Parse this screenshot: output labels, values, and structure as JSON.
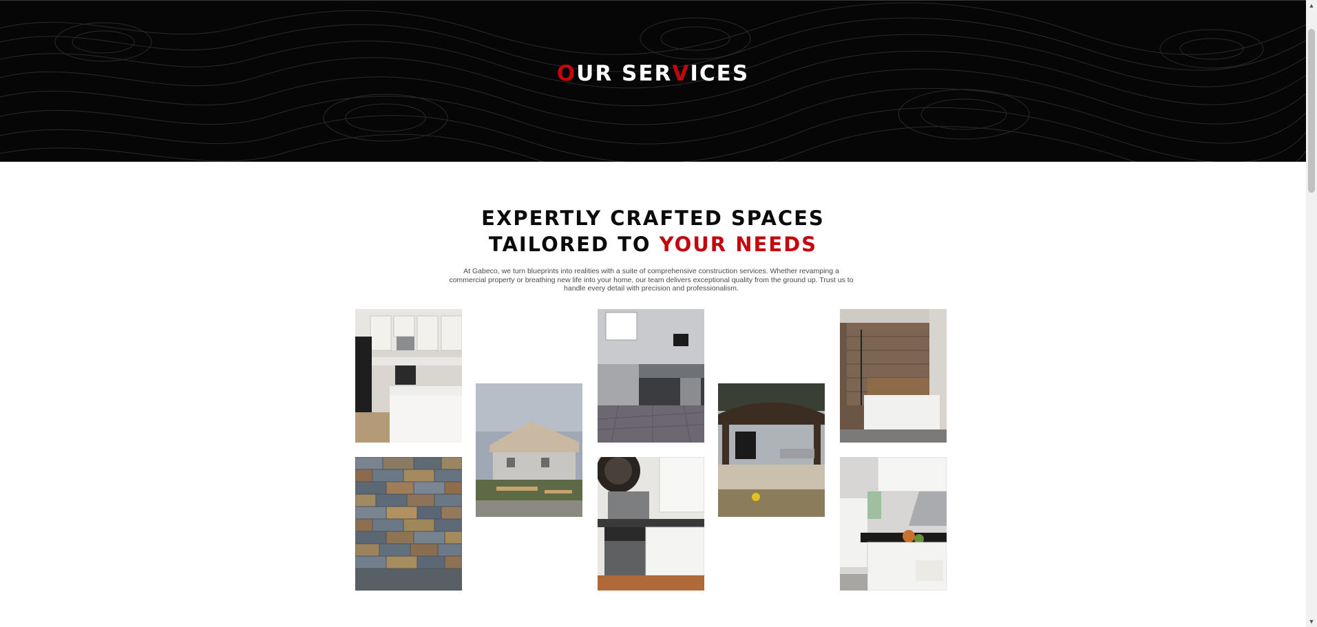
{
  "hero": {
    "title_parts": [
      "O",
      "UR SER",
      "V",
      "ICES"
    ],
    "background_color": "#060606",
    "accent_color": "#c4060d"
  },
  "intro": {
    "heading_line1": "EXPERTLY CRAFTED SPACES",
    "heading_line2_plain": "TAILORED TO ",
    "heading_line2_accent": "YOUR NEEDS",
    "description": "At Gabeco, we turn blueprints into realities with a suite of comprehensive construction services. Whether revamping a commercial property or breathing new life into your home, our team delivers exceptional quality from the ground up. Trust us to handle every detail with precision and professionalism."
  },
  "gallery": [
    {
      "subject": "kitchen-white-cabinets-island"
    },
    {
      "subject": "house-under-construction"
    },
    {
      "subject": "outdoor-kitchen-grill"
    },
    {
      "subject": "outdoor-gazebo-kitchen"
    },
    {
      "subject": "bathroom-tile-shower-tub"
    },
    {
      "subject": "slate-stone-accent-wall"
    },
    {
      "subject": "kitchen-stainless-appliances"
    },
    {
      "subject": "kitchen-range-hood"
    }
  ]
}
